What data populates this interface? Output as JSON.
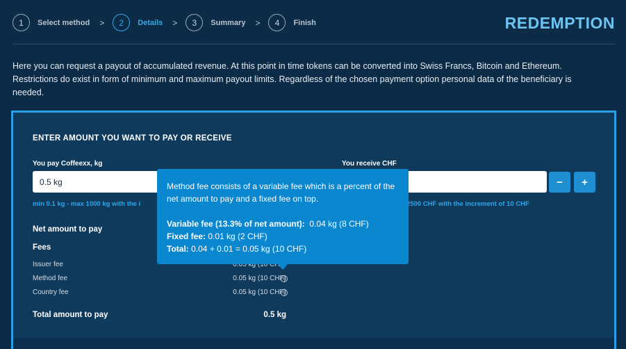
{
  "steps": [
    {
      "number": "1",
      "label": "Select method",
      "sep": ">"
    },
    {
      "number": "2",
      "label": "Details",
      "sep": ">"
    },
    {
      "number": "3",
      "label": "Summary",
      "sep": ">"
    },
    {
      "number": "4",
      "label": "Finish"
    }
  ],
  "page_title": "REDEMPTION",
  "intro": "Here you can request a payout of accumulated revenue. At this point in time tokens can be converted into Swiss Francs, Bitcoin and Ethereum. Restrictions do exist in form of minimum and maximum payout limits. Regardless of the chosen payment option personal data of the beneficiary is needed.",
  "form": {
    "title": "ENTER AMOUNT YOU WANT TO PAY OR RECEIVE",
    "pay_label": "You pay Coffeexx, kg",
    "pay_value": "0.5 kg",
    "pay_hint": "min 0.1 kg - max 1000 kg with the i",
    "receive_label": "You receive CHF",
    "receive_value": "",
    "receive_hint": "2500 CHF with the increment of 10 CHF",
    "minus_label": "−",
    "plus_label": "+"
  },
  "summary": {
    "net_label": "Net amount to pay",
    "fees_label": "Fees",
    "issuer_fee_label": "Issuer fee",
    "issuer_fee_value": "0.05 kg (10 CHF)",
    "method_fee_label": "Method fee",
    "method_fee_value": "0.05 kg (10 CHF)",
    "country_fee_label": "Country fee",
    "country_fee_value": "0.05 kg (10 CHF)",
    "total_label": "Total amount to pay",
    "total_value": "0.5 kg",
    "info_glyph": "i"
  },
  "tooltip": {
    "line1": "Method fee consists of a variable fee which is a percent of the net amount to pay and a fixed fee on top.",
    "variable_label": "Variable fee (13.3% of net amount):",
    "variable_value": "0.04 kg (8 CHF)",
    "fixed_label": "Fixed fee:",
    "fixed_value": "0.01 kg (2 CHF)",
    "total_label": "Total:",
    "total_value": "0.04 + 0.01 = 0.05 kg (10 CHF)"
  },
  "colors": {
    "background": "#0c2b46",
    "card": "#0f3a5c",
    "accent": "#2b9fe6",
    "tooltip": "#0a87cf",
    "title": "#6cc4f2"
  }
}
